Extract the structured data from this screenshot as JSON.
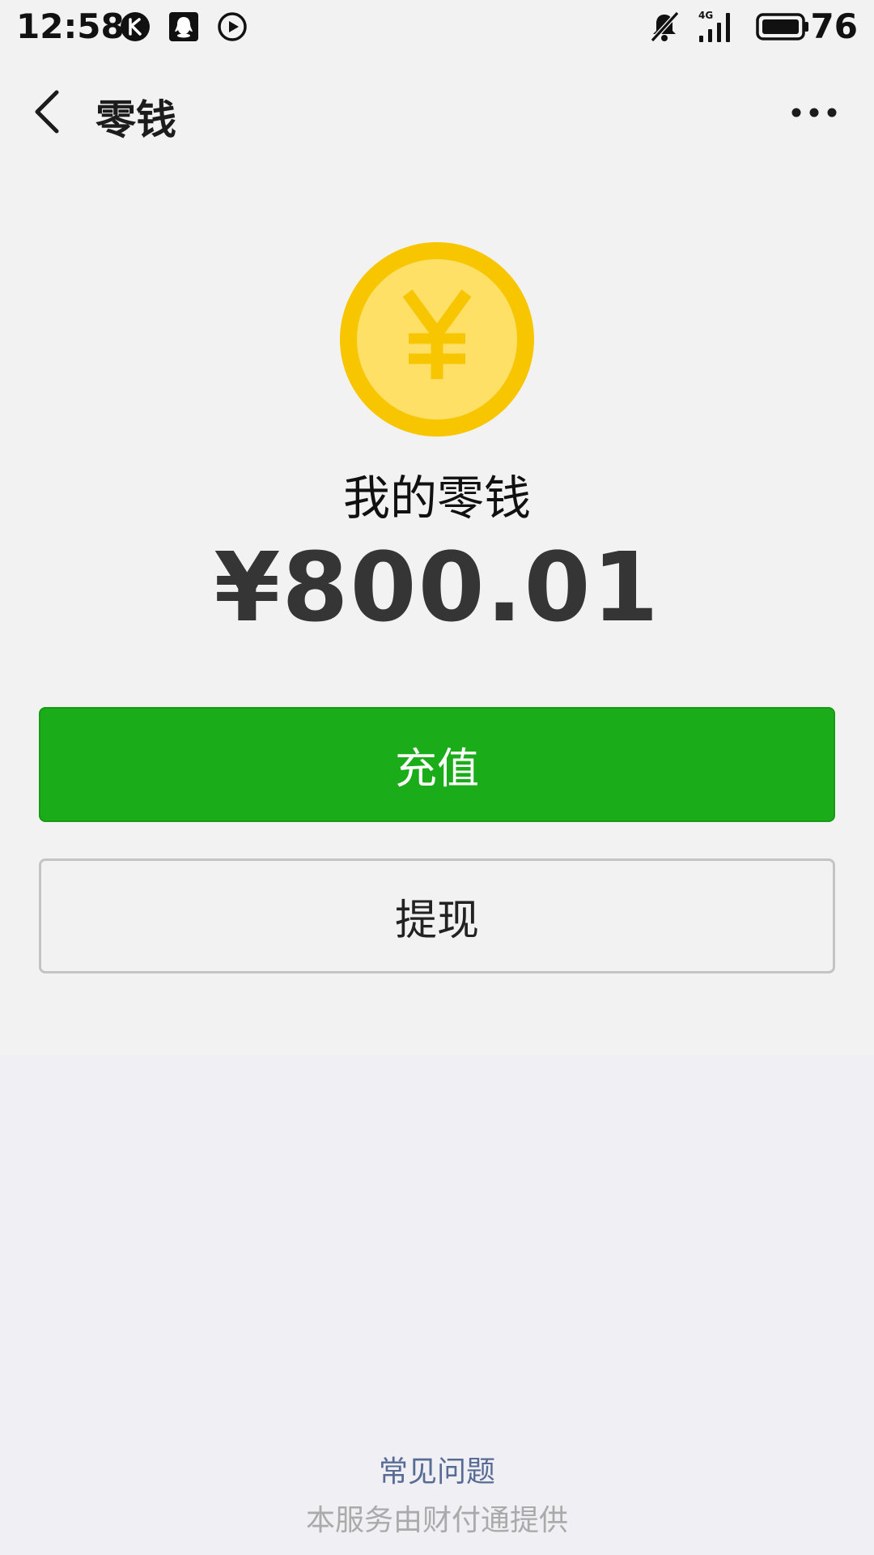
{
  "status_bar": {
    "time": "12:58",
    "app_icons": [
      "k-app-icon",
      "qq-icon",
      "play-icon"
    ],
    "right_icons": [
      "mute-bell-icon",
      "signal-4g-icon",
      "battery-icon"
    ],
    "network_label": "4G",
    "battery_level": "76"
  },
  "nav": {
    "title": "零钱",
    "back_icon": "chevron-left-icon",
    "more_icon": "more-dots-icon"
  },
  "wallet": {
    "coin_icon": "yuan-coin-icon",
    "label": "我的零钱",
    "amount": "¥800.01"
  },
  "actions": {
    "recharge_label": "充值",
    "withdraw_label": "提现"
  },
  "footer": {
    "faq_label": "常见问题",
    "provider_text": "本服务由财付通提供"
  },
  "colors": {
    "accent_green": "#1aad19",
    "coin_outer": "#f7c600",
    "coin_inner": "#ffe066",
    "link_blue": "#576b95"
  }
}
